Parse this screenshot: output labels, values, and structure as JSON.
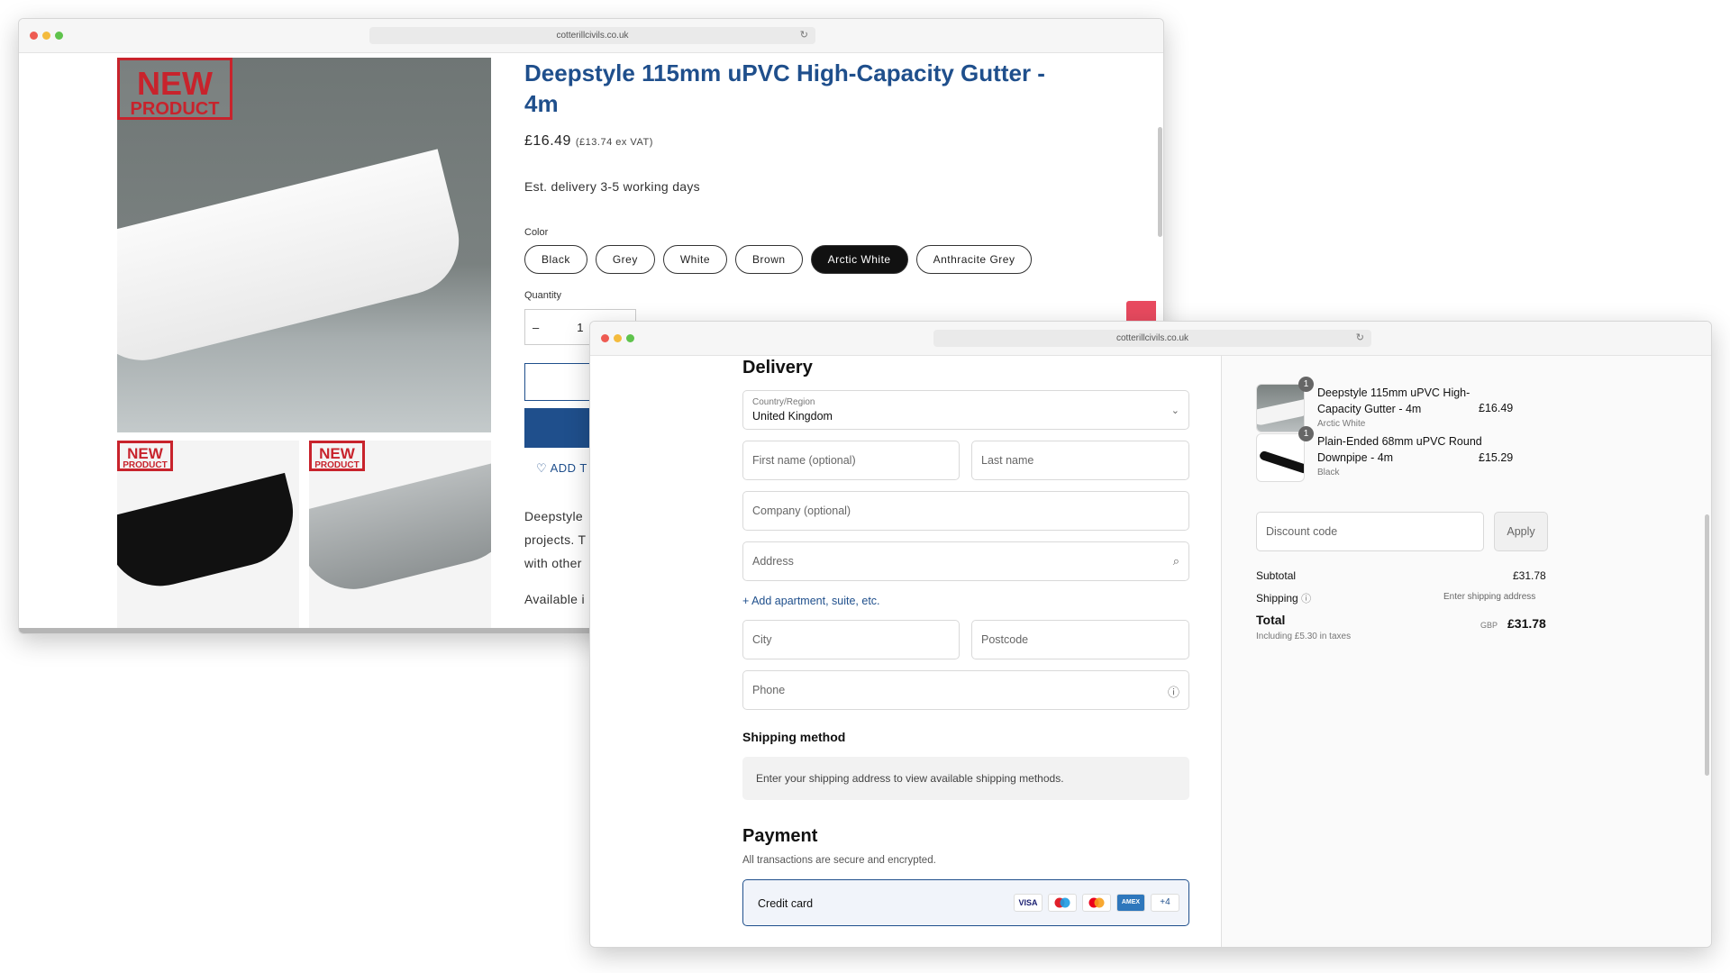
{
  "product_window": {
    "url": "cotterillcivils.co.uk",
    "badge_line1": "NEW",
    "badge_line2": "PRODUCT",
    "title": "Deepstyle 115mm uPVC High-Capacity Gutter - 4m",
    "price": "£16.49",
    "price_ex_vat": "(£13.74 ex VAT)",
    "delivery": "Est. delivery 3-5 working days",
    "color_label": "Color",
    "colors": [
      "Black",
      "Grey",
      "White",
      "Brown",
      "Arctic White",
      "Anthracite Grey"
    ],
    "selected_color": "Arctic White",
    "quantity_label": "Quantity",
    "quantity_minus": "–",
    "quantity_value": "1",
    "wishlist": "ADD T",
    "desc_lines": [
      "Deepstyle",
      "projects. T",
      "with other"
    ],
    "available": "Available i"
  },
  "checkout_window": {
    "url": "cotterillcivils.co.uk",
    "delivery_heading": "Delivery",
    "country_label": "Country/Region",
    "country_value": "United Kingdom",
    "first_name": "First name (optional)",
    "last_name": "Last name",
    "company": "Company (optional)",
    "address": "Address",
    "add_apartment": "+ Add apartment, suite, etc.",
    "city": "City",
    "postcode": "Postcode",
    "phone": "Phone",
    "shipping_heading": "Shipping method",
    "shipping_info": "Enter your shipping address to view available shipping methods.",
    "payment_heading": "Payment",
    "payment_sub": "All transactions are secure and encrypted.",
    "credit_card": "Credit card",
    "card_more": "+4",
    "items": [
      {
        "qty": "1",
        "name": "Deepstyle 115mm uPVC High-Capacity Gutter - 4m",
        "variant": "Arctic White",
        "price": "£16.49"
      },
      {
        "qty": "1",
        "name": "Plain-Ended 68mm uPVC Round Downpipe - 4m",
        "variant": "Black",
        "price": "£15.29"
      }
    ],
    "discount_placeholder": "Discount code",
    "apply": "Apply",
    "subtotal_label": "Subtotal",
    "subtotal": "£31.78",
    "shipping_label": "Shipping",
    "shipping_value": "Enter shipping address",
    "total_label": "Total",
    "taxes": "Including £5.30 in taxes",
    "currency": "GBP",
    "total": "£31.78"
  },
  "colors": {
    "brand_blue": "#1f4f8c",
    "badge_red": "#c8232c",
    "selected_swatch": "#111111"
  }
}
